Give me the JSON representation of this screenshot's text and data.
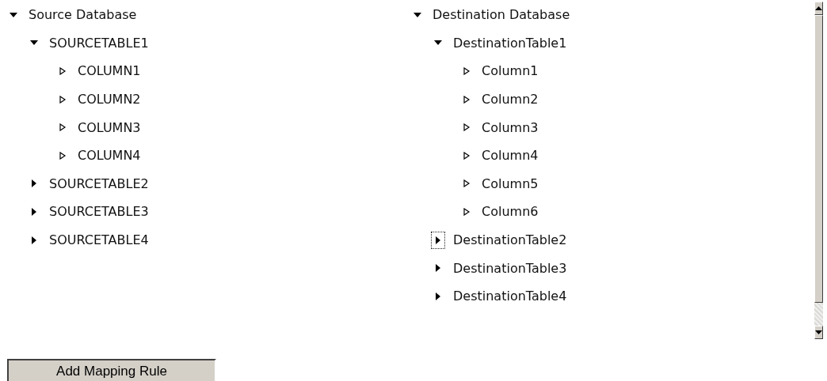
{
  "trees": [
    {
      "label": "Source Database",
      "expanded": true,
      "children": [
        {
          "label": "SOURCETABLE1",
          "expanded": true,
          "focused": false,
          "children": [
            {
              "label": "COLUMN1",
              "kind": "leaf"
            },
            {
              "label": "COLUMN2",
              "kind": "leaf"
            },
            {
              "label": "COLUMN3",
              "kind": "leaf"
            },
            {
              "label": "COLUMN4",
              "kind": "leaf"
            }
          ]
        },
        {
          "label": "SOURCETABLE2",
          "expanded": false,
          "focused": false
        },
        {
          "label": "SOURCETABLE3",
          "expanded": false,
          "focused": false
        },
        {
          "label": "SOURCETABLE4",
          "expanded": false,
          "focused": false
        }
      ]
    },
    {
      "label": "Destination Database",
      "expanded": true,
      "children": [
        {
          "label": "DestinationTable1",
          "expanded": true,
          "focused": false,
          "children": [
            {
              "label": "Column1",
              "kind": "leaf"
            },
            {
              "label": "Column2",
              "kind": "leaf"
            },
            {
              "label": "Column3",
              "kind": "leaf"
            },
            {
              "label": "Column4",
              "kind": "leaf"
            },
            {
              "label": "Column5",
              "kind": "leaf"
            },
            {
              "label": "Column6",
              "kind": "leaf"
            }
          ]
        },
        {
          "label": "DestinationTable2",
          "expanded": false,
          "focused": true
        },
        {
          "label": "DestinationTable3",
          "expanded": false,
          "focused": false
        },
        {
          "label": "DestinationTable4",
          "expanded": false,
          "focused": false
        }
      ]
    }
  ],
  "button": "Add Mapping Rule"
}
